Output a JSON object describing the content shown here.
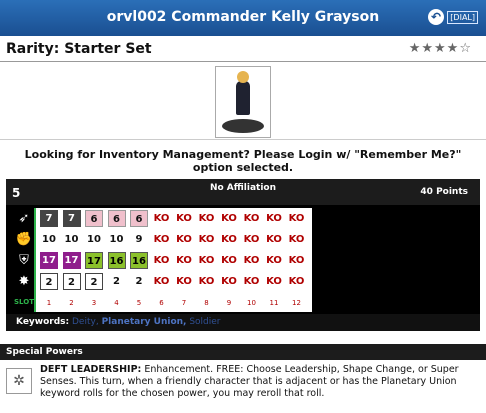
{
  "header": {
    "title": "orvl002 Commander Kelly Grayson",
    "dial_label": "[DIAL]",
    "back_icon": "rotate-back-icon"
  },
  "rarity": "Rarity: Starter Set",
  "rating": {
    "stars_filled": 4,
    "stars_total": 5,
    "text": "★★★★☆"
  },
  "login_text": "Looking for Inventory Management? Please Login w/ \"Remember Me?\" option selected.",
  "card": {
    "speed": "5",
    "affiliation": "No Affiliation",
    "points": "40 Points",
    "icons": [
      "speed-icon",
      "attack-icon",
      "defense-icon",
      "damage-icon"
    ],
    "slot_label": "SLOT",
    "rows": [
      [
        "7",
        "7",
        "6",
        "6",
        "6",
        "KO",
        "KO",
        "KO",
        "KO",
        "KO",
        "KO",
        "KO"
      ],
      [
        "10",
        "10",
        "10",
        "10",
        "9",
        "KO",
        "KO",
        "KO",
        "KO",
        "KO",
        "KO",
        "KO"
      ],
      [
        "17",
        "17",
        "17",
        "16",
        "16",
        "KO",
        "KO",
        "KO",
        "KO",
        "KO",
        "KO",
        "KO"
      ],
      [
        "2",
        "2",
        "2",
        "2",
        "2",
        "KO",
        "KO",
        "KO",
        "KO",
        "KO",
        "KO",
        "KO"
      ]
    ],
    "slots": [
      "1",
      "2",
      "3",
      "4",
      "5",
      "6",
      "7",
      "8",
      "9",
      "10",
      "11",
      "12"
    ],
    "keywords_label": "Keywords:",
    "keywords": [
      "Deity,",
      "Planetary Union,",
      "Soldier"
    ]
  },
  "special_powers": {
    "header": "Special Powers",
    "icon": "star-burst-icon",
    "name": "DEFT LEADERSHIP:",
    "text": "Enhancement. FREE: Choose Leadership, Shape Change, or Super Senses. This turn, when a friendly character that is adjacent or has the Planetary Union keyword rolls for the chosen power, you may reroll that roll."
  },
  "colors": {
    "title_bar": "#1a4f91",
    "ko": "#b00000",
    "purple": "#8f1d8c",
    "green": "#8bc12b",
    "pink": "#f0c0cc"
  }
}
